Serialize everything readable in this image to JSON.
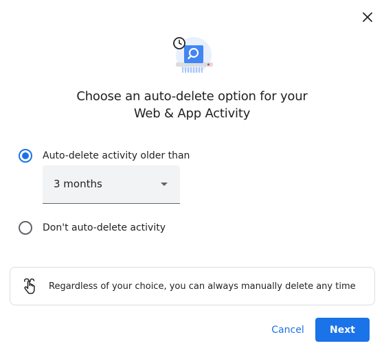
{
  "dialog": {
    "title_line1": "Choose an auto-delete option for your",
    "title_line2": "Web & App Activity"
  },
  "options": [
    {
      "label": "Auto-delete activity older than",
      "selected": true
    },
    {
      "label": "Don't auto-delete activity",
      "selected": false
    }
  ],
  "period_select": {
    "value": "3 months"
  },
  "info": {
    "text": "Regardless of your choice, you can always manually delete any time"
  },
  "actions": {
    "cancel_label": "Cancel",
    "next_label": "Next"
  },
  "colors": {
    "accent": "#1a73e8",
    "text": "#202124",
    "select_bg": "#f1f3f4",
    "border": "#dadce0"
  },
  "icons": {
    "close": "close-icon",
    "hero": "auto-delete-illustration",
    "info": "hand-touch-icon",
    "dropdown": "dropdown-arrow-icon"
  }
}
